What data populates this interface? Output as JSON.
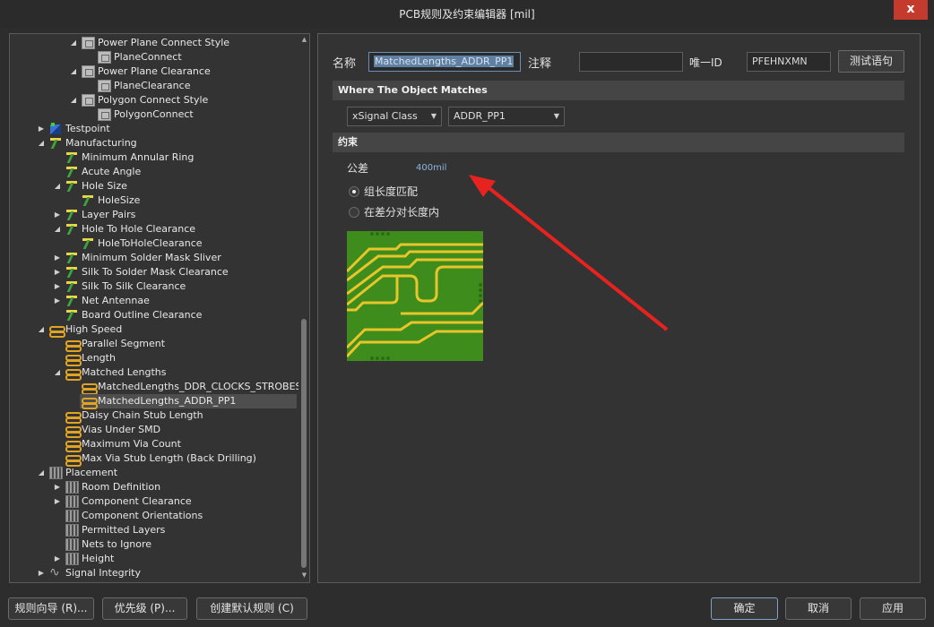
{
  "window": {
    "title": "PCB规则及约束编辑器 [mil]",
    "close_glyph": "x"
  },
  "tree": {
    "items": [
      {
        "label": "Power Plane Connect Style",
        "icon": "plane-rule-icon",
        "arrow": "down"
      },
      {
        "label": "PlaneConnect",
        "icon": "plane-rule-icon",
        "arrow": ""
      },
      {
        "label": "Power Plane Clearance",
        "icon": "plane-rule-icon",
        "arrow": "down"
      },
      {
        "label": "PlaneClearance",
        "icon": "plane-rule-icon",
        "arrow": ""
      },
      {
        "label": "Polygon Connect Style",
        "icon": "plane-rule-icon",
        "arrow": "down"
      },
      {
        "label": "PolygonConnect",
        "icon": "plane-rule-icon",
        "arrow": ""
      },
      {
        "label": "Testpoint",
        "icon": "testpoint-icon",
        "arrow": "right"
      },
      {
        "label": "Manufacturing",
        "icon": "manufacturing-icon",
        "arrow": "down"
      },
      {
        "label": "Minimum Annular Ring",
        "icon": "manufacturing-icon",
        "arrow": ""
      },
      {
        "label": "Acute Angle",
        "icon": "manufacturing-icon",
        "arrow": ""
      },
      {
        "label": "Hole Size",
        "icon": "manufacturing-icon",
        "arrow": "down"
      },
      {
        "label": "HoleSize",
        "icon": "manufacturing-icon",
        "arrow": ""
      },
      {
        "label": "Layer Pairs",
        "icon": "manufacturing-icon",
        "arrow": "right"
      },
      {
        "label": "Hole To Hole Clearance",
        "icon": "manufacturing-icon",
        "arrow": "down"
      },
      {
        "label": "HoleToHoleClearance",
        "icon": "manufacturing-icon",
        "arrow": ""
      },
      {
        "label": "Minimum Solder Mask Sliver",
        "icon": "manufacturing-icon",
        "arrow": "right"
      },
      {
        "label": "Silk To Solder Mask Clearance",
        "icon": "manufacturing-icon",
        "arrow": "right"
      },
      {
        "label": "Silk To Silk Clearance",
        "icon": "manufacturing-icon",
        "arrow": "right"
      },
      {
        "label": "Net Antennae",
        "icon": "manufacturing-icon",
        "arrow": "right"
      },
      {
        "label": "Board Outline Clearance",
        "icon": "manufacturing-icon",
        "arrow": ""
      },
      {
        "label": "High Speed",
        "icon": "high-speed-icon",
        "arrow": "down"
      },
      {
        "label": "Parallel Segment",
        "icon": "high-speed-icon",
        "arrow": ""
      },
      {
        "label": "Length",
        "icon": "high-speed-icon",
        "arrow": ""
      },
      {
        "label": "Matched Lengths",
        "icon": "high-speed-icon",
        "arrow": "down"
      },
      {
        "label": "MatchedLengths_DDR_CLOCKS_STROBES",
        "icon": "high-speed-icon",
        "arrow": ""
      },
      {
        "label": "MatchedLengths_ADDR_PP1",
        "icon": "high-speed-icon",
        "arrow": ""
      },
      {
        "label": "Daisy Chain Stub Length",
        "icon": "high-speed-icon",
        "arrow": ""
      },
      {
        "label": "Vias Under SMD",
        "icon": "high-speed-icon",
        "arrow": ""
      },
      {
        "label": "Maximum Via Count",
        "icon": "high-speed-icon",
        "arrow": ""
      },
      {
        "label": "Max Via Stub Length (Back Drilling)",
        "icon": "high-speed-icon",
        "arrow": ""
      },
      {
        "label": "Placement",
        "icon": "placement-icon",
        "arrow": "down"
      },
      {
        "label": "Room Definition",
        "icon": "placement-icon",
        "arrow": "right"
      },
      {
        "label": "Component Clearance",
        "icon": "placement-icon",
        "arrow": "right"
      },
      {
        "label": "Component Orientations",
        "icon": "placement-icon",
        "arrow": ""
      },
      {
        "label": "Permitted Layers",
        "icon": "placement-icon",
        "arrow": ""
      },
      {
        "label": "Nets to Ignore",
        "icon": "placement-icon",
        "arrow": ""
      },
      {
        "label": "Height",
        "icon": "placement-icon",
        "arrow": "right"
      },
      {
        "label": "Signal Integrity",
        "icon": "signal-integrity-icon",
        "arrow": "right"
      }
    ]
  },
  "rule": {
    "name_label": "名称",
    "name_value": "MatchedLengths_ADDR_PP1",
    "comment_label": "注释",
    "comment_value": "",
    "unique_id_label": "唯一ID",
    "unique_id_value": "PFEHNXMN",
    "test_query_button": "测试语句"
  },
  "where_matches": {
    "header": "Where The Object Matches",
    "type_select": "xSignal Class",
    "value_select": "ADDR_PP1"
  },
  "constraints": {
    "header": "约束",
    "tolerance_label": "公差",
    "tolerance_value": "400mil",
    "options": [
      {
        "label": "组长度匹配",
        "checked": true
      },
      {
        "label": "在差分对长度内",
        "checked": false
      }
    ]
  },
  "buttons": {
    "rule_wizard": "规则向导 (R)...",
    "priorities": "优先级 (P)...",
    "create_default": "创建默认规则 (C)",
    "ok": "确定",
    "cancel": "取消",
    "apply": "应用"
  },
  "colors": {
    "annotation_arrow": "#e8231f",
    "pcb_board": "#3e8c1c",
    "pcb_trace": "#e8c52a"
  }
}
